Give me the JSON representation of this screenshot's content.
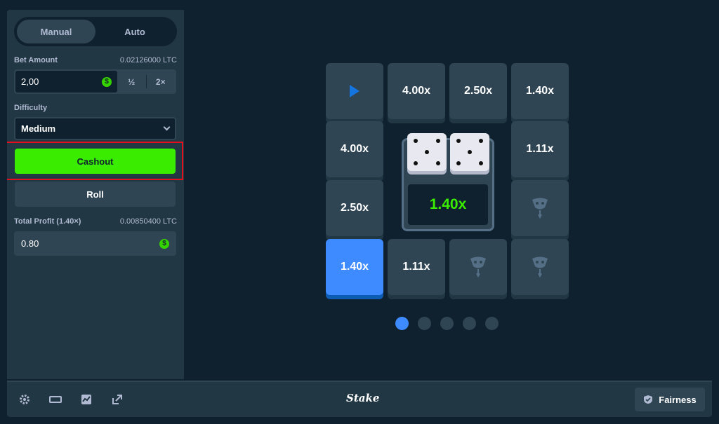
{
  "mode_tabs": [
    "Manual",
    "Auto"
  ],
  "bet": {
    "label": "Bet Amount",
    "crypto_value": "0.02126000 LTC",
    "value": "2,00",
    "half_label": "½",
    "double_label": "2×",
    "currency_icon": "$"
  },
  "difficulty": {
    "label": "Difficulty",
    "selected": "Medium"
  },
  "actions": {
    "cashout_label": "Cashout",
    "roll_label": "Roll"
  },
  "profit": {
    "label": "Total Profit (1.40×)",
    "crypto_value": "0.00850400 LTC",
    "value": "0.80",
    "currency_icon": "$"
  },
  "board": {
    "top_row": [
      "4.00x",
      "2.50x",
      "1.40x"
    ],
    "left_col": [
      "4.00x",
      "2.50x"
    ],
    "right_col": [
      "1.11x"
    ],
    "bottom_row": [
      "1.40x",
      "1.11x"
    ],
    "current_multiplier": "1.40x"
  },
  "footer": {
    "logo": "Stake",
    "fairness_label": "Fairness"
  },
  "colors": {
    "accent_green": "#39ec00",
    "accent_blue": "#3d8bff",
    "panel": "#213743",
    "background": "#0f212e",
    "highlight_red": "#e4101e"
  }
}
